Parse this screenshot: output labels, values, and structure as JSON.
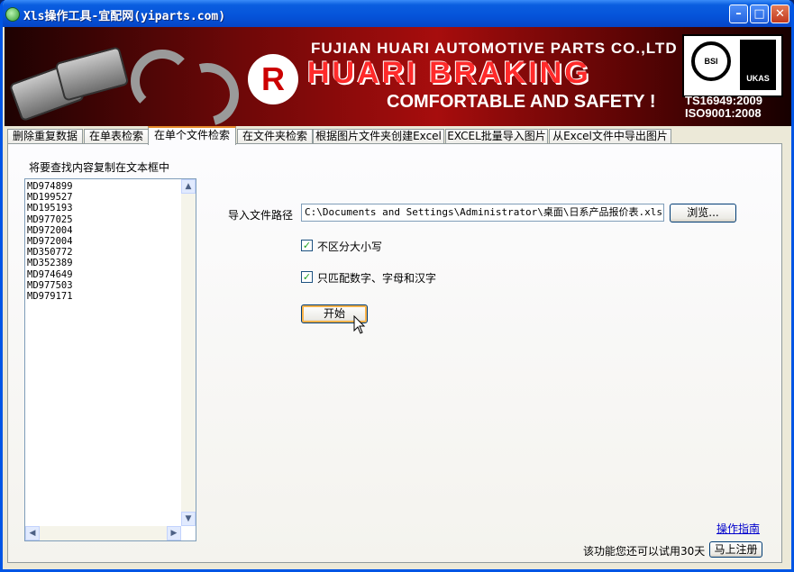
{
  "window": {
    "title": "Xls操作工具-宜配网(yiparts.com)"
  },
  "banner": {
    "company": "FUJIAN HUARI AUTOMOTIVE PARTS CO.,LTD",
    "brand": "HUARI BRAKING",
    "slogan": "COMFORTABLE AND SAFETY !",
    "certs": [
      "TS16949:2009",
      "ISO9001:2008"
    ],
    "bsi_label": "BSI",
    "ukas_label": "UKAS"
  },
  "tabs": [
    {
      "label": "删除重复数据"
    },
    {
      "label": "在单表检索"
    },
    {
      "label": "在单个文件检索"
    },
    {
      "label": "在文件夹检索"
    },
    {
      "label": "根据图片文件夹创建Excel"
    },
    {
      "label": "EXCEL批量导入图片"
    },
    {
      "label": "从Excel文件中导出图片"
    }
  ],
  "active_tab": "在单个文件检索",
  "left": {
    "instruction": "将要查找内容复制在文本框中",
    "lines": [
      "MD974899",
      "MD199527",
      "MD195193",
      "MD977025",
      "MD972004",
      "MD972004",
      "MD350772",
      "MD352389",
      "MD974649",
      "MD977503",
      "MD979171"
    ]
  },
  "form": {
    "path_label": "导入文件路径",
    "path_value": "C:\\Documents and Settings\\Administrator\\桌面\\日系产品报价表.xls",
    "browse_label": "浏览...",
    "case_label": "不区分大小写",
    "case_checked": true,
    "match_label": "只匹配数字、字母和汉字",
    "match_checked": true,
    "start_label": "开始"
  },
  "footer": {
    "guide_link": "操作指南",
    "trial_text": "该功能您还可以试用30天",
    "register_label": "马上注册"
  }
}
